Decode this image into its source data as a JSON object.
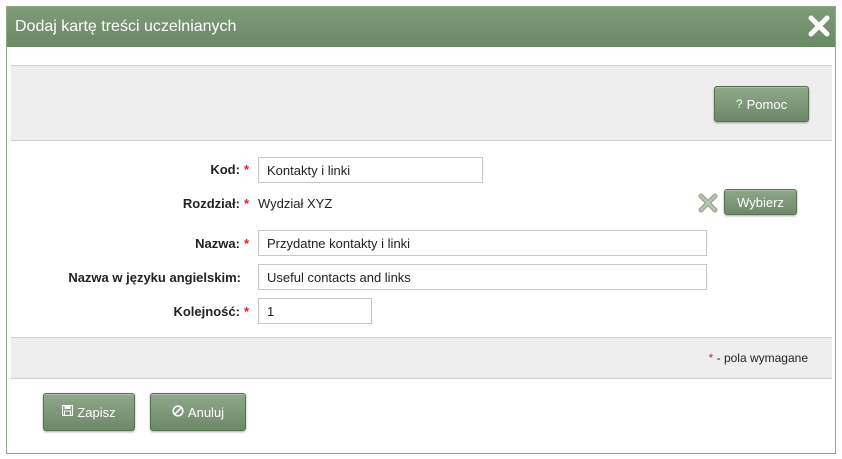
{
  "dialog": {
    "title": "Dodaj kartę treści uczelnianych",
    "close_icon": "close-x-icon"
  },
  "toolbar": {
    "help_label": "Pomoc",
    "help_icon": "?"
  },
  "form": {
    "required_marker": "*",
    "code": {
      "label": "Kod:",
      "value": "Kontakty i linki"
    },
    "chapter": {
      "label": "Rozdział:",
      "value": "Wydział XYZ",
      "clear_icon": "clear-x-icon",
      "choose_label": "Wybierz"
    },
    "name": {
      "label": "Nazwa:",
      "value": "Przydatne kontakty i linki"
    },
    "name_en": {
      "label": "Nazwa w języku angielskim:",
      "value": "Useful contacts and links"
    },
    "order": {
      "label": "Kolejność:",
      "value": "1"
    }
  },
  "legend": {
    "marker": "*",
    "text": " - pola wymagane"
  },
  "footer": {
    "save_label": "Zapisz",
    "save_icon": "save-icon",
    "cancel_label": "Anuluj",
    "cancel_icon": "cancel-icon"
  },
  "colors": {
    "titlebar": "#7593700",
    "button": "#7a9575",
    "required": "#e02020"
  }
}
